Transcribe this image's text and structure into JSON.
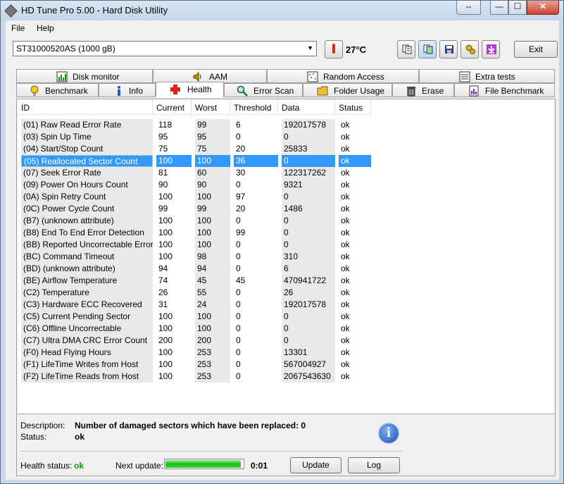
{
  "window": {
    "title": "HD Tune Pro 5.00 - Hard Disk Utility",
    "restore_glyph": "⇔",
    "min_glyph": "—",
    "max_glyph": "☐",
    "close_glyph": "✕"
  },
  "menu": {
    "file": "File",
    "help": "Help"
  },
  "toolbar": {
    "drive": "ST31000520AS (1000 gB)",
    "temperature": "27°C",
    "exit_label": "Exit",
    "buttons": [
      "copy-text-icon",
      "copy-screenshot-icon",
      "save-icon",
      "options-icon",
      "download-icon"
    ]
  },
  "tabs": {
    "row1": [
      "Disk monitor",
      "AAM",
      "Random Access",
      "Extra tests"
    ],
    "row2": [
      "Benchmark",
      "Info",
      "Health",
      "Error Scan",
      "Folder Usage",
      "Erase",
      "File Benchmark"
    ],
    "active": "Health"
  },
  "table": {
    "columns": [
      "ID",
      "Current",
      "Worst",
      "Threshold",
      "Data",
      "Status"
    ],
    "selected_index": 3,
    "rows": [
      [
        "(01) Raw Read Error Rate",
        "118",
        "99",
        "6",
        "192017578",
        "ok"
      ],
      [
        "(03) Spin Up Time",
        "95",
        "95",
        "0",
        "0",
        "ok"
      ],
      [
        "(04) Start/Stop Count",
        "75",
        "75",
        "20",
        "25833",
        "ok"
      ],
      [
        "(05) Reallocated Sector Count",
        "100",
        "100",
        "36",
        "0",
        "ok"
      ],
      [
        "(07) Seek Error Rate",
        "81",
        "60",
        "30",
        "122317262",
        "ok"
      ],
      [
        "(09) Power On Hours Count",
        "90",
        "90",
        "0",
        "9321",
        "ok"
      ],
      [
        "(0A) Spin Retry Count",
        "100",
        "100",
        "97",
        "0",
        "ok"
      ],
      [
        "(0C) Power Cycle Count",
        "99",
        "99",
        "20",
        "1486",
        "ok"
      ],
      [
        "(B7) (unknown attribute)",
        "100",
        "100",
        "0",
        "0",
        "ok"
      ],
      [
        "(B8) End To End Error Detection",
        "100",
        "100",
        "99",
        "0",
        "ok"
      ],
      [
        "(BB) Reported Uncorrectable Errors",
        "100",
        "100",
        "0",
        "0",
        "ok"
      ],
      [
        "(BC) Command Timeout",
        "100",
        "98",
        "0",
        "310",
        "ok"
      ],
      [
        "(BD) (unknown attribute)",
        "94",
        "94",
        "0",
        "6",
        "ok"
      ],
      [
        "(BE) Airflow Temperature",
        "74",
        "45",
        "45",
        "470941722",
        "ok"
      ],
      [
        "(C2) Temperature",
        "26",
        "55",
        "0",
        "26",
        "ok"
      ],
      [
        "(C3) Hardware ECC Recovered",
        "31",
        "24",
        "0",
        "192017578",
        "ok"
      ],
      [
        "(C5) Current Pending Sector",
        "100",
        "100",
        "0",
        "0",
        "ok"
      ],
      [
        "(C6) Offline Uncorrectable",
        "100",
        "100",
        "0",
        "0",
        "ok"
      ],
      [
        "(C7) Ultra DMA CRC Error Count",
        "200",
        "200",
        "0",
        "0",
        "ok"
      ],
      [
        "(F0) Head Flying Hours",
        "100",
        "253",
        "0",
        "13301",
        "ok"
      ],
      [
        "(F1) LifeTime Writes from Host",
        "100",
        "253",
        "0",
        "567004927",
        "ok"
      ],
      [
        "(F2) LifeTime Reads from Host",
        "100",
        "253",
        "0",
        "2067543630",
        "ok"
      ]
    ]
  },
  "details": {
    "description_label": "Description:",
    "description": "Number of damaged sectors which have been replaced: 0",
    "status_label": "Status:",
    "status": "ok",
    "info_glyph": "i"
  },
  "footer": {
    "health_label": "Health status:",
    "health_value": "ok",
    "next_update_label": "Next update:",
    "next_update_value": "0:01",
    "progress": 0.97,
    "update_button": "Update",
    "log_button": "Log"
  },
  "colors": {
    "selection": "#3399ff",
    "ok_green": "#00a000",
    "title_bg": "#c9d9ea"
  }
}
